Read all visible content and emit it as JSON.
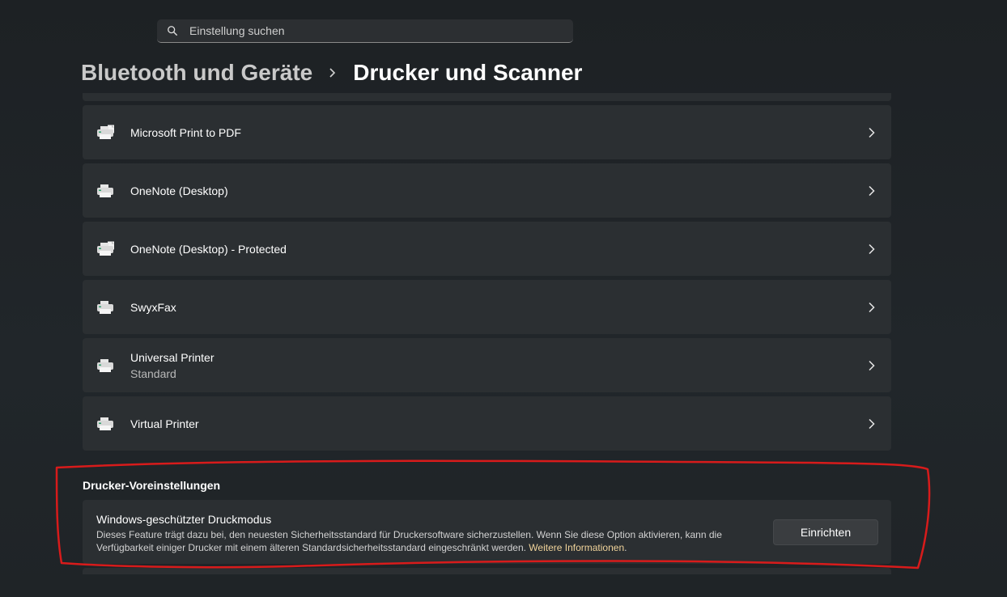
{
  "search": {
    "placeholder": "Einstellung suchen"
  },
  "breadcrumb": {
    "parent": "Bluetooth und Geräte",
    "current": "Drucker und Scanner"
  },
  "printers": [
    {
      "name": "Microsoft Print to PDF",
      "sub": "",
      "icon": "printer-document-icon"
    },
    {
      "name": "OneNote (Desktop)",
      "sub": "",
      "icon": "printer-icon"
    },
    {
      "name": "OneNote (Desktop) - Protected",
      "sub": "",
      "icon": "printer-document-icon"
    },
    {
      "name": "SwyxFax",
      "sub": "",
      "icon": "printer-icon"
    },
    {
      "name": "Universal Printer",
      "sub": "Standard",
      "icon": "printer-icon"
    },
    {
      "name": "Virtual Printer",
      "sub": "",
      "icon": "printer-icon"
    }
  ],
  "preferences": {
    "section_title": "Drucker-Voreinstellungen",
    "protected_mode": {
      "title": "Windows-geschützter Druckmodus",
      "description_1": "Dieses Feature trägt dazu bei, den neuesten Sicherheitsstandard für Druckersoftware sicherzustellen. Wenn Sie diese Option aktivieren, kann die Verfügbarkeit einiger Drucker mit einem älteren Standardsicherheitsstandard eingeschränkt werden. ",
      "link": "Weitere Informationen",
      "description_2": ".",
      "button": "Einrichten"
    }
  },
  "colors": {
    "background": "#1f2326",
    "card": "#2b2f32",
    "link": "#f0d39a",
    "annotation": "#d81b1b"
  }
}
